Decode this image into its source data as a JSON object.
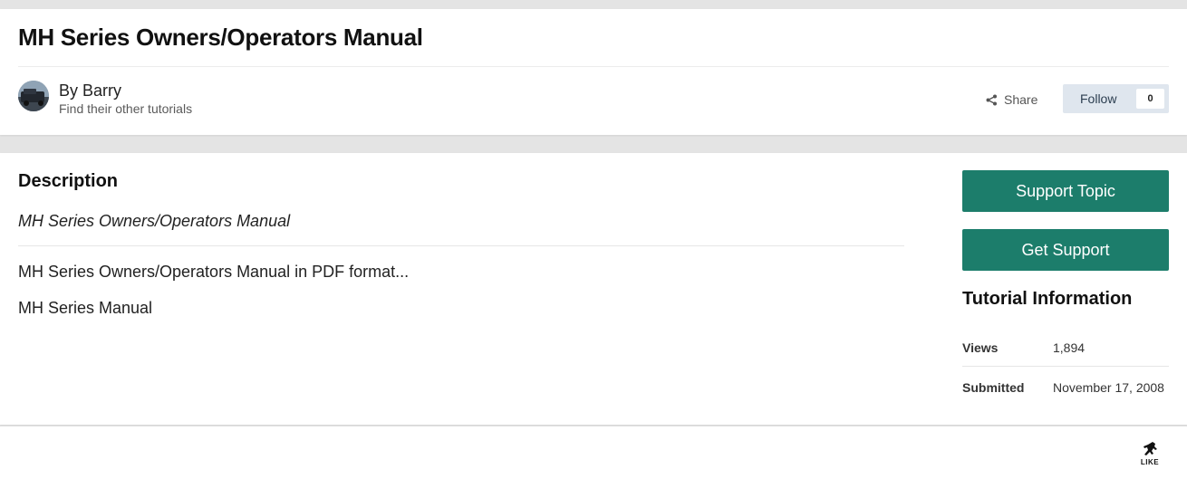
{
  "header": {
    "title": "MH Series Owners/Operators Manual",
    "author_name": "By Barry",
    "author_link": "Find their other tutorials",
    "share_label": "Share",
    "follow_label": "Follow",
    "follow_count": "0",
    "share_icon": "share-icon",
    "avatar_icon": "user-avatar"
  },
  "description": {
    "heading": "Description",
    "italic_title": "MH Series Owners/Operators Manual",
    "line1": "MH Series Owners/Operators Manual in PDF format...",
    "line2": "MH Series Manual"
  },
  "sidebar": {
    "support_topic_label": "Support Topic",
    "get_support_label": "Get Support",
    "info_heading": "Tutorial Information",
    "info_rows": [
      {
        "label": "Views",
        "value": "1,894"
      },
      {
        "label": "Submitted",
        "value": "November 17, 2008"
      }
    ]
  },
  "footer": {
    "like_label": "LIKE",
    "like_icon": "like-figure-icon"
  },
  "colors": {
    "accent_button": "#1c7d6b",
    "follow_bg": "#dfe6ee",
    "page_bg": "#e4e4e4"
  }
}
